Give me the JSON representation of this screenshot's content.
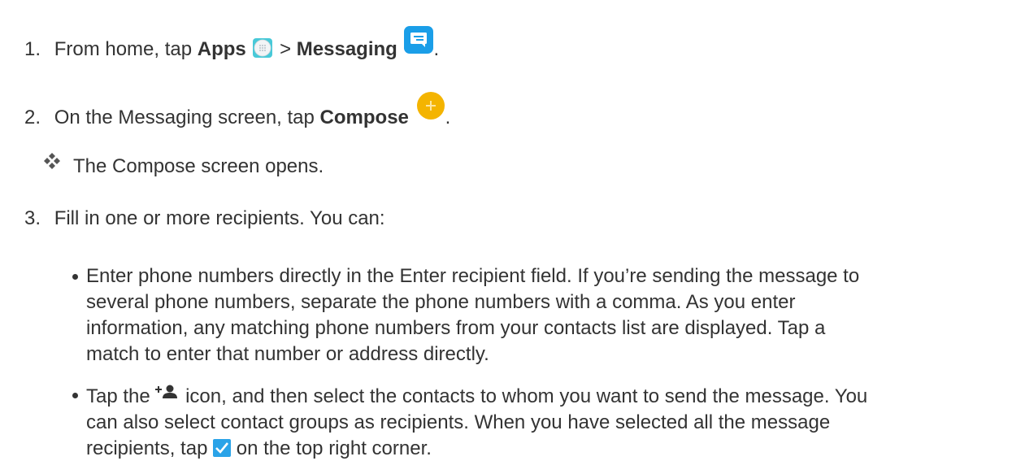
{
  "steps": [
    {
      "number": "1.",
      "text_before": "From home, tap ",
      "bold1": "Apps",
      "sep": " > ",
      "bold2": "Messaging",
      "end": "."
    },
    {
      "number": "2.",
      "text_before": "On the Messaging screen, tap ",
      "bold1": "Compose",
      "end": "."
    },
    {
      "result": "The Compose screen opens."
    },
    {
      "number": "3.",
      "text": "Fill in one or more recipients. You can:"
    }
  ],
  "bullets": [
    {
      "lines": [
        "Enter phone numbers directly in the Enter recipient field. If you’re sending the message to",
        "several phone numbers, separate the phone numbers with a comma. As you enter",
        "information, any matching phone numbers from your contacts list are displayed. Tap a",
        "match to enter that number or address directly."
      ]
    },
    {
      "line1_before": "Tap the ",
      "line1_after": " icon, and then select the contacts to whom you want to send the message. You",
      "line2": "can also select contact groups as recipients. When you have selected all the message",
      "line3_before": "recipients, tap ",
      "line3_after": " on the top right corner."
    }
  ],
  "icons": {
    "apps": "apps-grid-icon",
    "messaging": "messaging-icon",
    "compose": "compose-plus-icon",
    "result": "result-diamonds-icon",
    "add_contact": "add-contact-icon",
    "checkmark": "checkmark-icon"
  },
  "colors": {
    "messaging_blue": "#1a9ee8",
    "compose_yellow": "#f4b400",
    "checkmark_blue": "#2aa3e8",
    "apps_teal": "#48c9d8"
  }
}
